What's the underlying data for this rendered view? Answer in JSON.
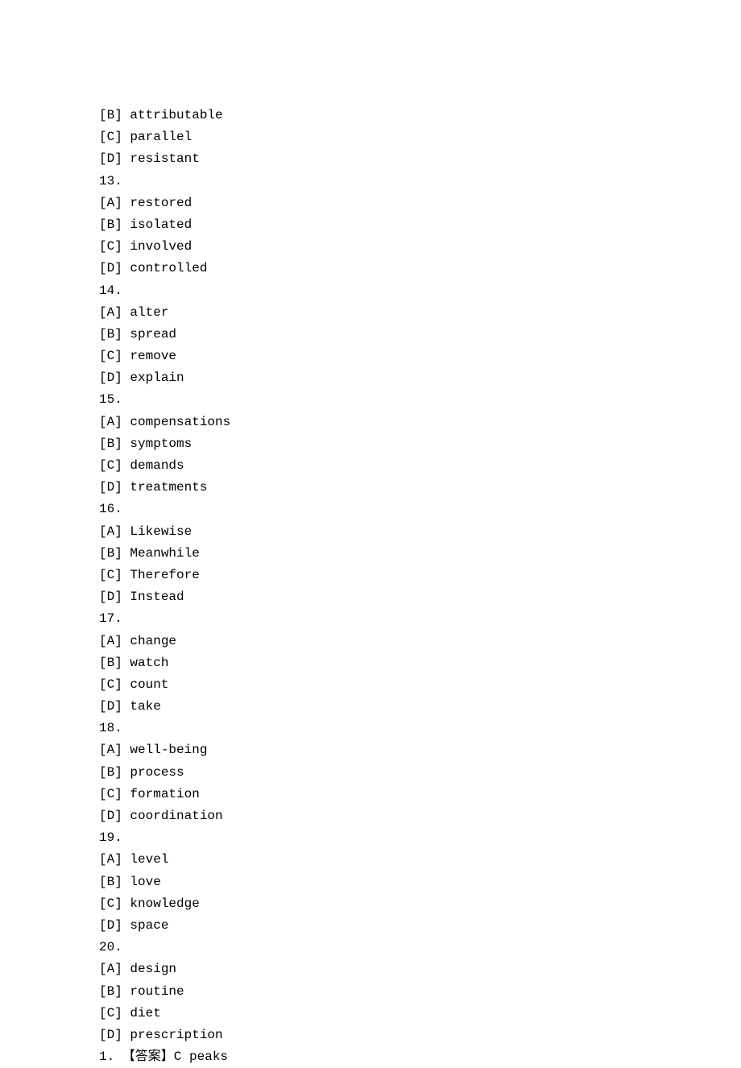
{
  "lines": [
    "[B] attributable",
    "[C] parallel",
    "[D] resistant",
    "13.",
    "[A] restored",
    "[B] isolated",
    "[C] involved",
    "[D] controlled",
    "14.",
    "[A] alter",
    "[B] spread",
    "[C] remove",
    "[D] explain",
    "15.",
    "[A] compensations",
    "[B] symptoms",
    "[C] demands",
    "[D] treatments",
    "16.",
    "[A] Likewise",
    "[B] Meanwhile",
    "[C] Therefore",
    "[D] Instead",
    "17.",
    "[A] change",
    "[B] watch",
    "[C] count",
    "[D] take",
    "18.",
    "[A] well-being",
    "[B] process",
    "[C] formation",
    "[D] coordination",
    "19.",
    "[A] level",
    "[B] love",
    "[C] knowledge",
    "[D] space",
    "20.",
    "[A] design",
    "[B] routine",
    "[C] diet",
    "[D] prescription",
    "1. 【答案】C peaks"
  ]
}
